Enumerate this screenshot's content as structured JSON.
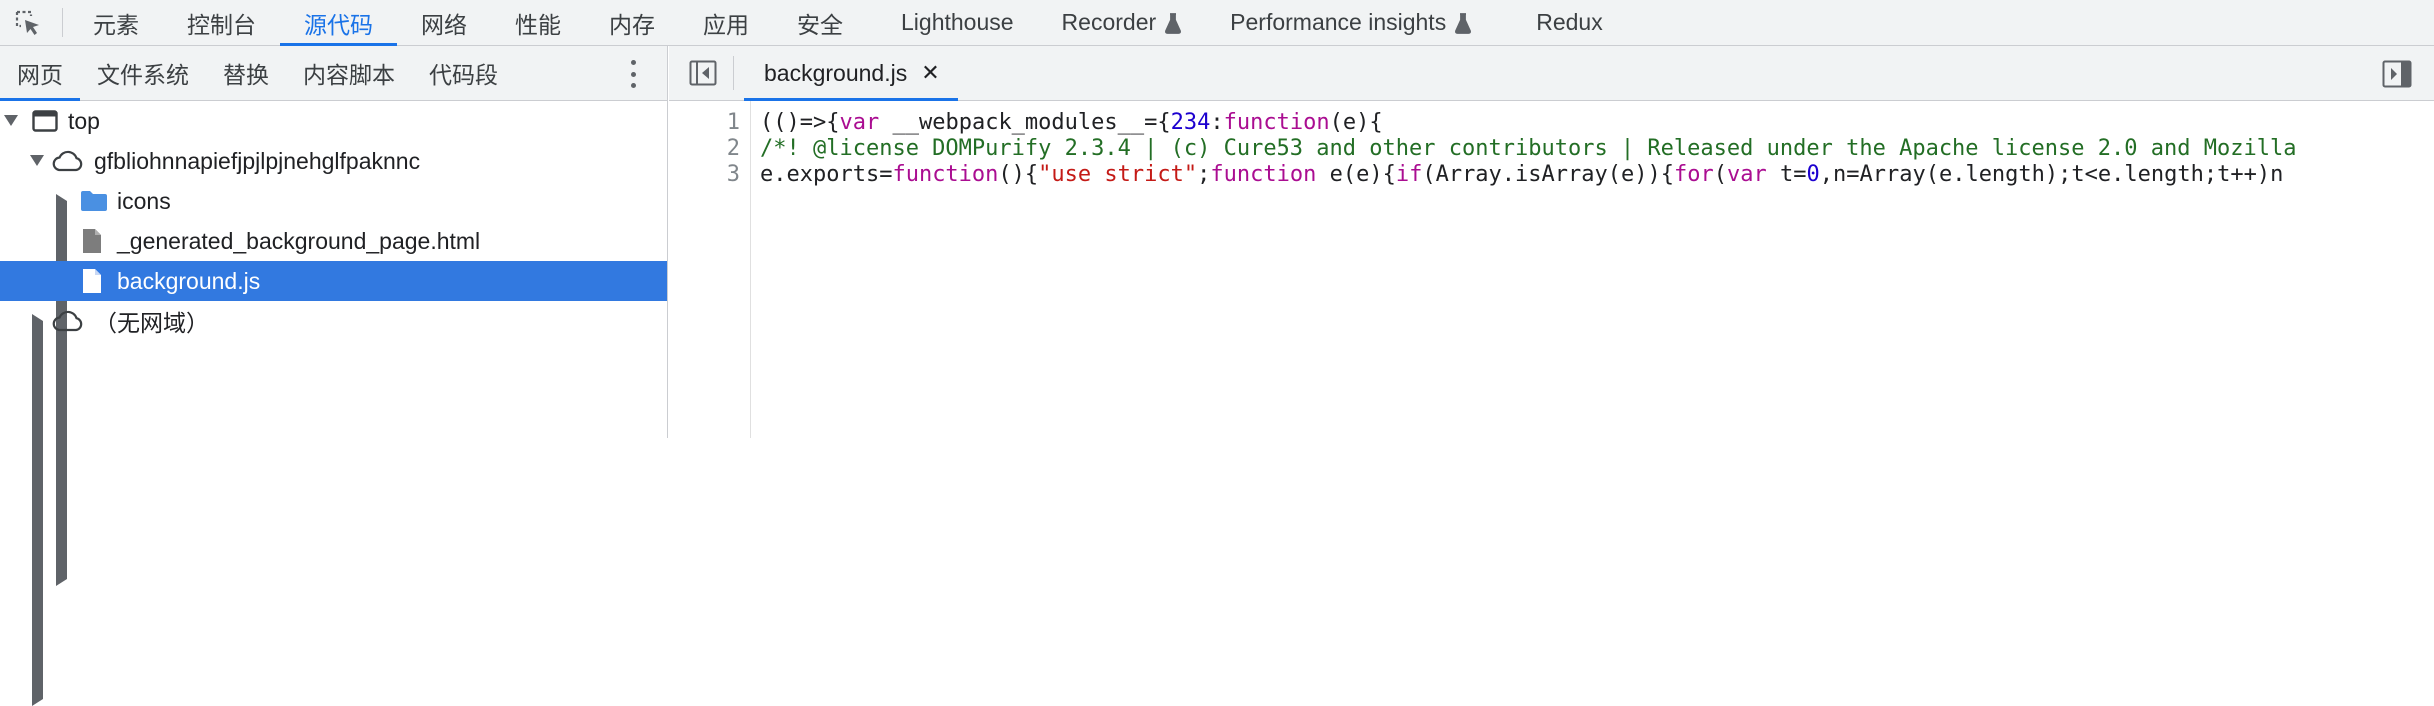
{
  "toolbar": {
    "tabs": [
      {
        "label": "元素"
      },
      {
        "label": "控制台"
      },
      {
        "label": "源代码"
      },
      {
        "label": "网络"
      },
      {
        "label": "性能"
      },
      {
        "label": "内存"
      },
      {
        "label": "应用"
      },
      {
        "label": "安全"
      },
      {
        "label": "Lighthouse"
      },
      {
        "label": "Recorder"
      },
      {
        "label": "Performance insights"
      },
      {
        "label": "Redux"
      }
    ],
    "active_tab": "源代码"
  },
  "navigator": {
    "tabs": [
      {
        "label": "网页"
      },
      {
        "label": "文件系统"
      },
      {
        "label": "替换"
      },
      {
        "label": "内容脚本"
      },
      {
        "label": "代码段"
      }
    ],
    "tree": {
      "top": "top",
      "origin": "gfbliohnnapiefjpjlpjnehglfpaknnc",
      "folder": "icons",
      "file1": "_generated_background_page.html",
      "file2": "background.js",
      "no_domain": "（无网域）"
    }
  },
  "editor": {
    "open_file": "background.js",
    "close_glyph": "✕",
    "line_numbers": [
      "1",
      "2",
      "3"
    ],
    "line1": {
      "a": "(()=>{",
      "b": "var",
      "c": " __webpack_modules__={",
      "d": "234",
      "e": ":",
      "f": "function",
      "g": "(e){"
    },
    "line2": "/*! @license DOMPurify 2.3.4 | (c) Cure53 and other contributors | Released under the Apache license 2.0 and Mozilla",
    "line3": {
      "a": "e.exports=",
      "b": "function",
      "c": "(){",
      "d": "\"use strict\"",
      "e": ";",
      "f": "function",
      "g": " e(e){",
      "h": "if",
      "i": "(Array.isArray(e)){",
      "j": "for",
      "k": "(",
      "l": "var",
      "m": " t=",
      "n": "0",
      "o": ",n=Array(e.length);t<e.length;t++)n"
    }
  },
  "colors": {
    "accent": "#1a73e8",
    "selection": "#3279e0",
    "keyword": "#aa0d91",
    "number": "#1c00cf",
    "string": "#c41a16",
    "comment": "#236e25"
  }
}
